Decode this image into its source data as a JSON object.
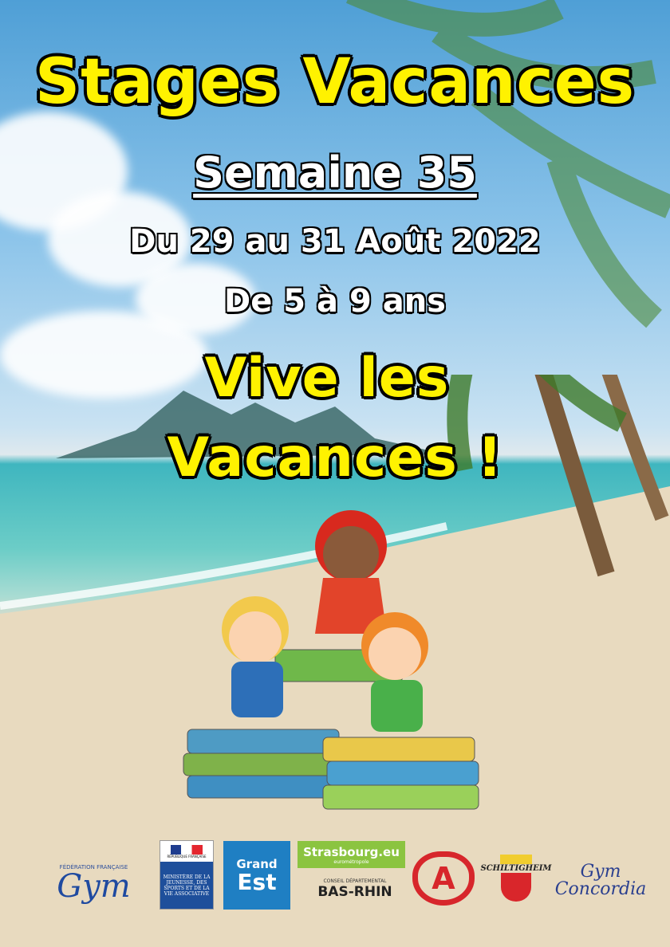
{
  "title": "Stages Vacances",
  "week": "Semaine 35",
  "dates": "Du 29 au 31 Août 2022",
  "ages": "De 5 à 9 ans",
  "slogan_line1": "Vive les",
  "slogan_line2": "Vacances !",
  "logos": {
    "ffgym_top": "FÉDÉRATION FRANÇAISE",
    "ffgym": "Gym",
    "ministere": "MINISTÈRE DE LA JEUNESSE, DES SPORTS ET DE LA VIE ASSOCIATIVE",
    "republique": "RÉPUBLIQUE FRANÇAISE",
    "grand_est_1": "Grand",
    "grand_est_2": "Est",
    "strasbourg": "Strasbourg.eu",
    "strasbourg_sub": "eurométropole",
    "bas_rhin_top": "CONSEIL DÉPARTEMENTAL",
    "bas_rhin": "BAS-RHIN",
    "alsace": "A",
    "schiltigheim": "SCHILTIGHEIM",
    "concordia_1": "Gym",
    "concordia_2": "Concordia"
  },
  "colors": {
    "yellow": "#fff200",
    "sky": "#4f9fd6",
    "sand": "#e6d8bc"
  }
}
